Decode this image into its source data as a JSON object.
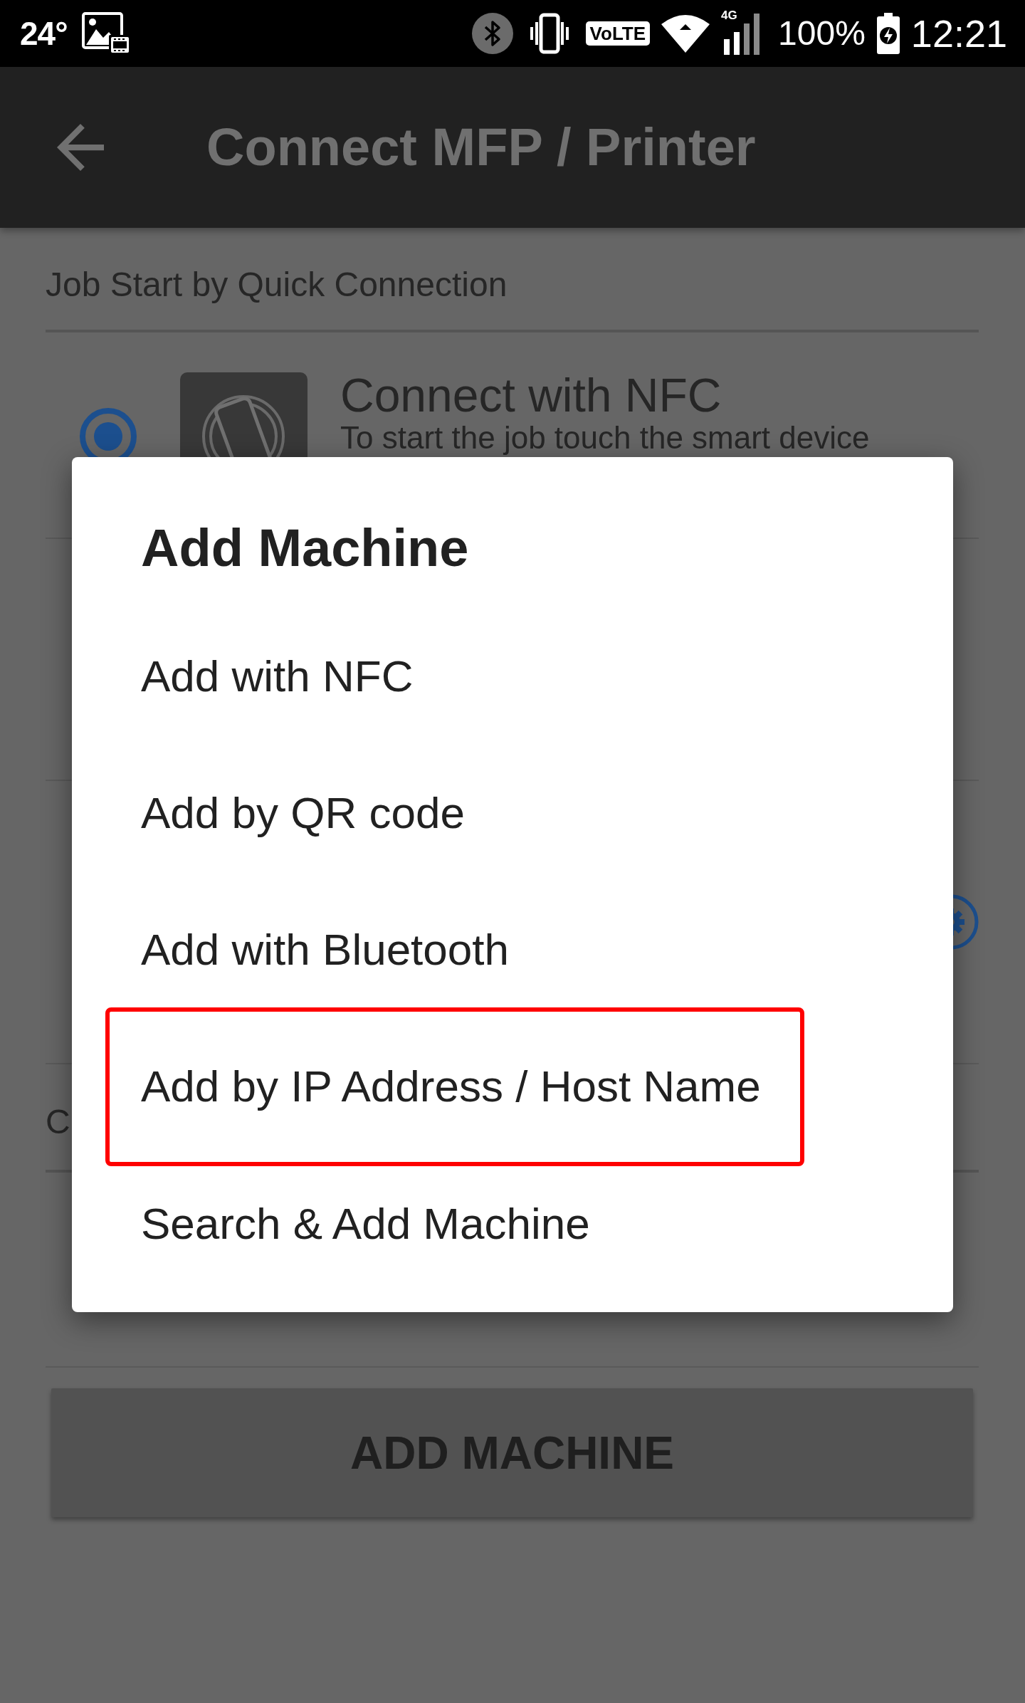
{
  "status_bar": {
    "temperature": "24°",
    "volte": "VoLTE",
    "network_type": "4G",
    "battery_level": "100%",
    "time": "12:21"
  },
  "app_bar": {
    "title": "Connect MFP / Printer"
  },
  "quick_connection": {
    "header": "Job Start by Quick Connection",
    "nfc_option": {
      "title": "Connect with NFC",
      "description": "To start the job touch the smart device",
      "selected": true
    }
  },
  "next_section": {
    "header": "C"
  },
  "add_machine_button": {
    "label": "ADD MACHINE"
  },
  "dialog": {
    "title": "Add Machine",
    "items": [
      {
        "label": "Add with NFC",
        "highlighted": false
      },
      {
        "label": "Add by QR code",
        "highlighted": false
      },
      {
        "label": "Add with Bluetooth",
        "highlighted": false
      },
      {
        "label": "Add by IP Address / Host Name",
        "highlighted": true
      },
      {
        "label": "Search & Add Machine",
        "highlighted": false
      }
    ]
  }
}
